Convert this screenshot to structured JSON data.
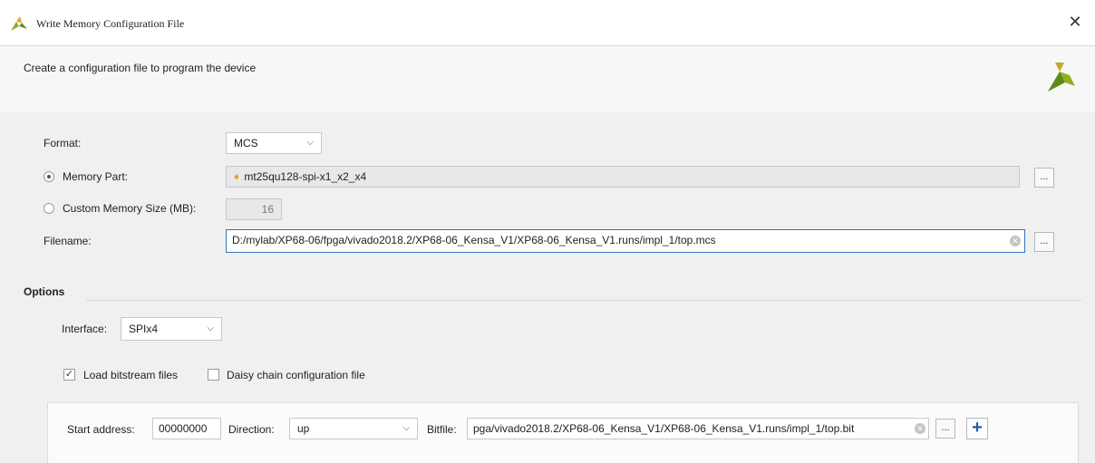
{
  "window": {
    "title": "Write Memory Configuration File",
    "close_glyph": "✕",
    "brand_color": "#8fb020",
    "accent_color": "#2f74c0"
  },
  "header": {
    "subtitle": "Create a configuration file to program the device"
  },
  "form": {
    "format_label": "Format:",
    "format_value": "MCS",
    "memory_part_label": "Memory Part:",
    "memory_part_value": "mt25qu128-spi-x1_x2_x4",
    "memory_part_selected": true,
    "custom_size_label": "Custom Memory Size (MB):",
    "custom_size_value": "16",
    "filename_label": "Filename:",
    "filename_value": "D:/mylab/XP68-06/fpga/vivado2018.2/XP68-06_Kensa_V1/XP68-06_Kensa_V1.runs/impl_1/top.mcs",
    "browse_label": "..."
  },
  "options": {
    "title": "Options",
    "interface_label": "Interface:",
    "interface_value": "SPIx4",
    "load_bitstream_label": "Load bitstream files",
    "load_bitstream_checked": true,
    "daisy_chain_label": "Daisy chain configuration file",
    "daisy_chain_checked": false
  },
  "bitstream_row": {
    "start_address_label": "Start address:",
    "start_address_value": "00000000",
    "direction_label": "Direction:",
    "direction_value": "up",
    "bitfile_label": "Bitfile:",
    "bitfile_value": "pga/vivado2018.2/XP68-06_Kensa_V1/XP68-06_Kensa_V1.runs/impl_1/top.bit",
    "browse_label": "...",
    "add_label": "+"
  }
}
